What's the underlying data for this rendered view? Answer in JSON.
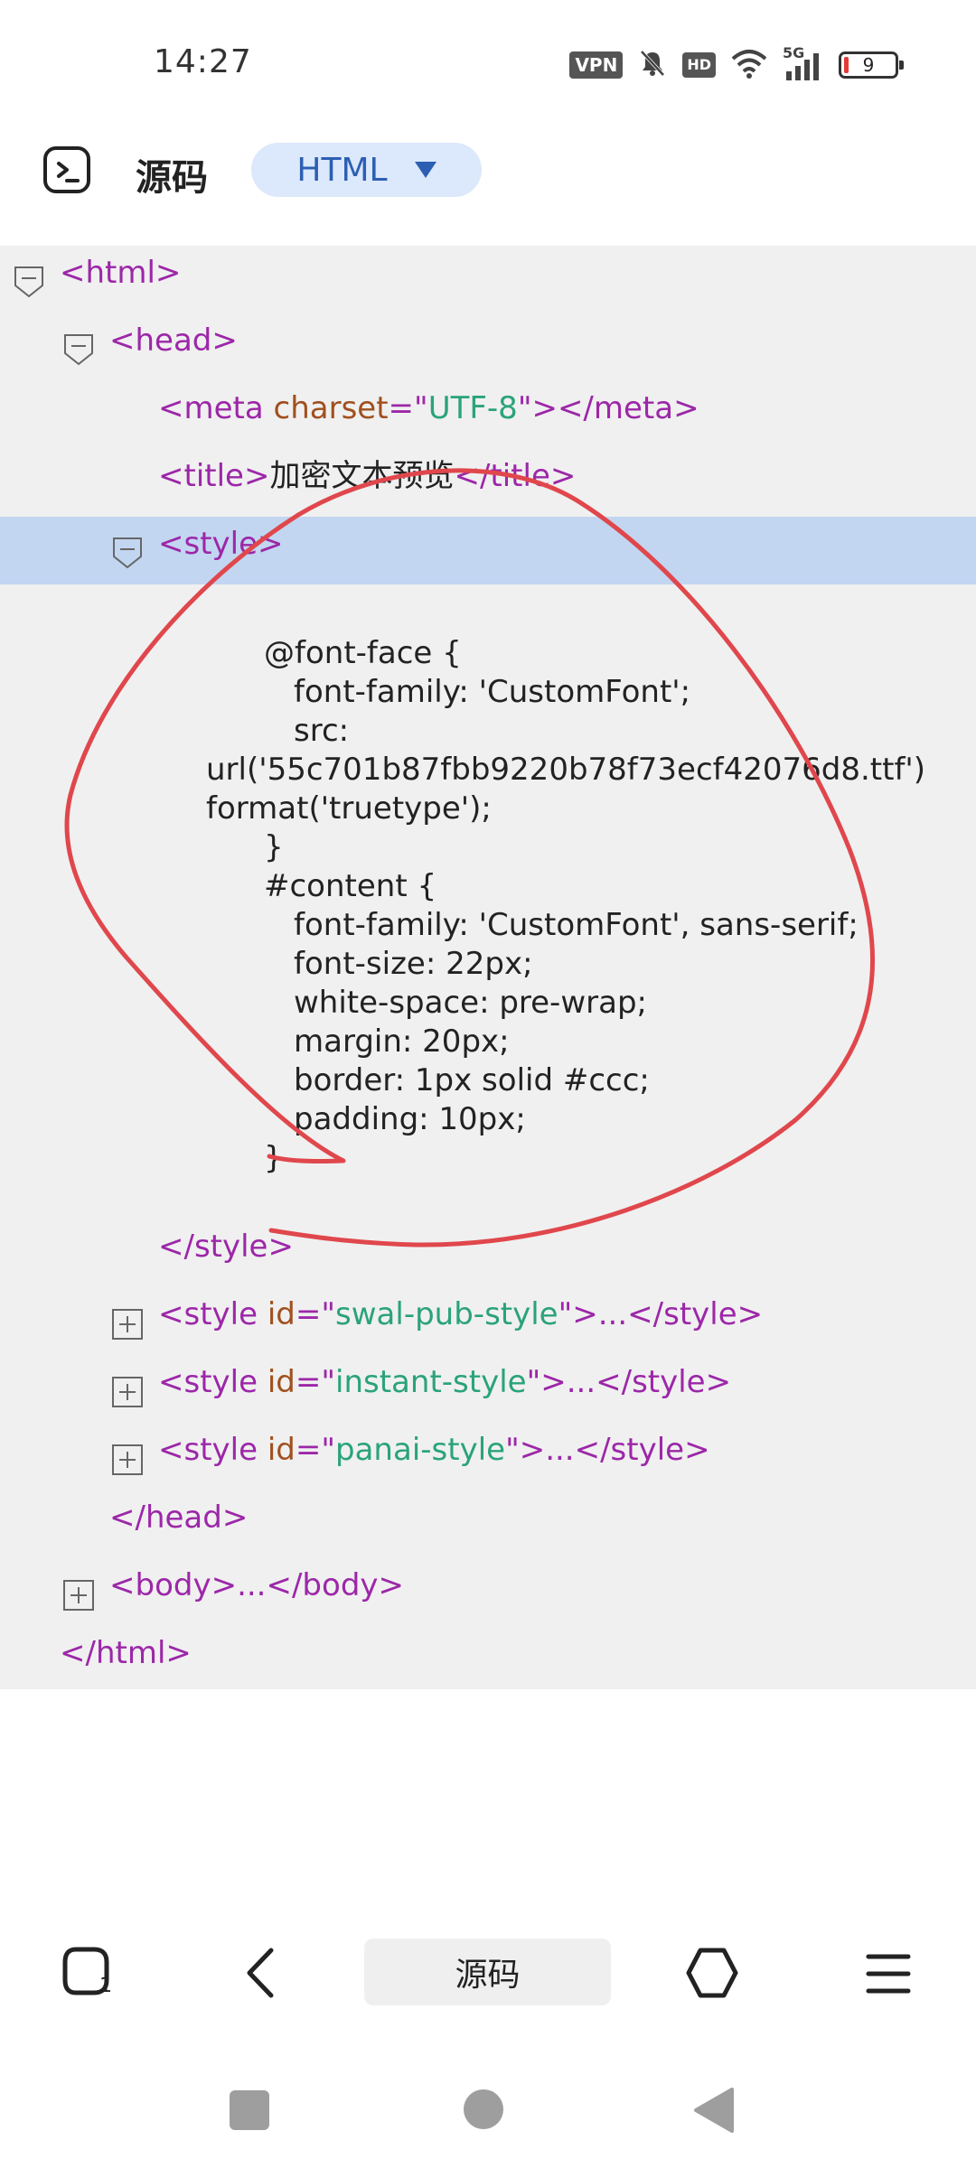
{
  "status_bar": {
    "time": "14:27",
    "vpn_badge": "VPN",
    "hd_badge": "HD",
    "network_label": "5G",
    "battery_level": "9"
  },
  "toolbar": {
    "title": "源码",
    "language": "HTML"
  },
  "code": {
    "html_open": "<html>",
    "head_open": "<head>",
    "meta_open": "<meta",
    "meta_attr": "charset",
    "meta_eq": "=\"",
    "meta_val": "UTF-8",
    "meta_close": "\"></meta>",
    "title_open": "<title>",
    "title_text": "加密文本预览",
    "title_close": "</title>",
    "style_open": "<style>",
    "css_lines": [
      "@font-face {",
      "font-family: 'CustomFont';",
      "src:",
      "url('55c701b87fbb9220b78f73ecf42076d8.ttf')",
      "format('truetype');",
      "}",
      "#content {",
      "font-family: 'CustomFont', sans-serif;",
      "font-size: 22px;",
      "white-space: pre-wrap;",
      "margin: 20px;",
      "border: 1px solid #ccc;",
      "padding: 10px;",
      "}"
    ],
    "style_close": "</style>",
    "style_tag_open": "<style",
    "id_attr": "id",
    "eq_quote": "=\"",
    "collapsed_tail": "\">...</style>",
    "style_ids": [
      "swal-pub-style",
      "instant-style",
      "panai-style"
    ],
    "head_close": "</head>",
    "body_collapsed": "<body>...</body>",
    "html_close": "</html>"
  },
  "bottom_nav": {
    "tab_count": "1",
    "center_label": "源码"
  },
  "colors": {
    "tag": "#9c27a8",
    "attribute": "#a0501e",
    "value": "#2aa37a",
    "selection": "#c2d6f1",
    "annotation": "#e0474c"
  }
}
